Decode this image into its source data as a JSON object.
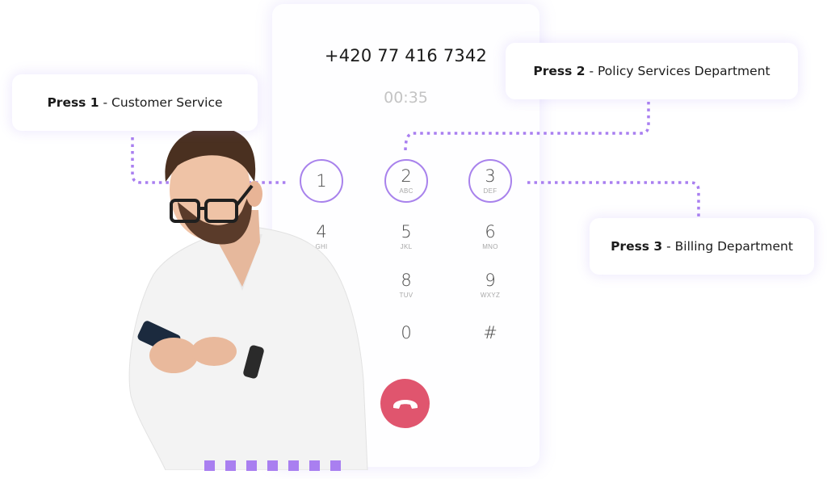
{
  "call": {
    "phone_number": "+420 77 416 7342",
    "elapsed": "00:35"
  },
  "keypad": {
    "keys": [
      {
        "digit": "1",
        "letters": "",
        "highlighted": true
      },
      {
        "digit": "2",
        "letters": "ABC",
        "highlighted": true
      },
      {
        "digit": "3",
        "letters": "DEF",
        "highlighted": true
      },
      {
        "digit": "4",
        "letters": "GHI",
        "highlighted": false
      },
      {
        "digit": "5",
        "letters": "JKL",
        "highlighted": false
      },
      {
        "digit": "6",
        "letters": "MNO",
        "highlighted": false
      },
      {
        "digit": "8",
        "letters": "TUV",
        "highlighted": false
      },
      {
        "digit": "9",
        "letters": "WXYZ",
        "highlighted": false
      },
      {
        "digit": "0",
        "letters": "",
        "highlighted": false
      },
      {
        "digit": "#",
        "letters": "",
        "highlighted": false
      }
    ],
    "end_call_icon": "phone-hangup-icon"
  },
  "menu_options": [
    {
      "press": "Press 1",
      "separator": " - ",
      "department": "Customer Service"
    },
    {
      "press": "Press 2",
      "separator": " - ",
      "department": "Policy Services Department"
    },
    {
      "press": "Press 3",
      "separator": " - ",
      "department": "Billing Department"
    }
  ],
  "colors": {
    "accent": "#a882ec",
    "connector": "#a97ff0",
    "end_call": "#e0556e",
    "timer": "#c4c4c4"
  },
  "illustration": {
    "subject": "man in white shirt with glasses using smartphone"
  }
}
